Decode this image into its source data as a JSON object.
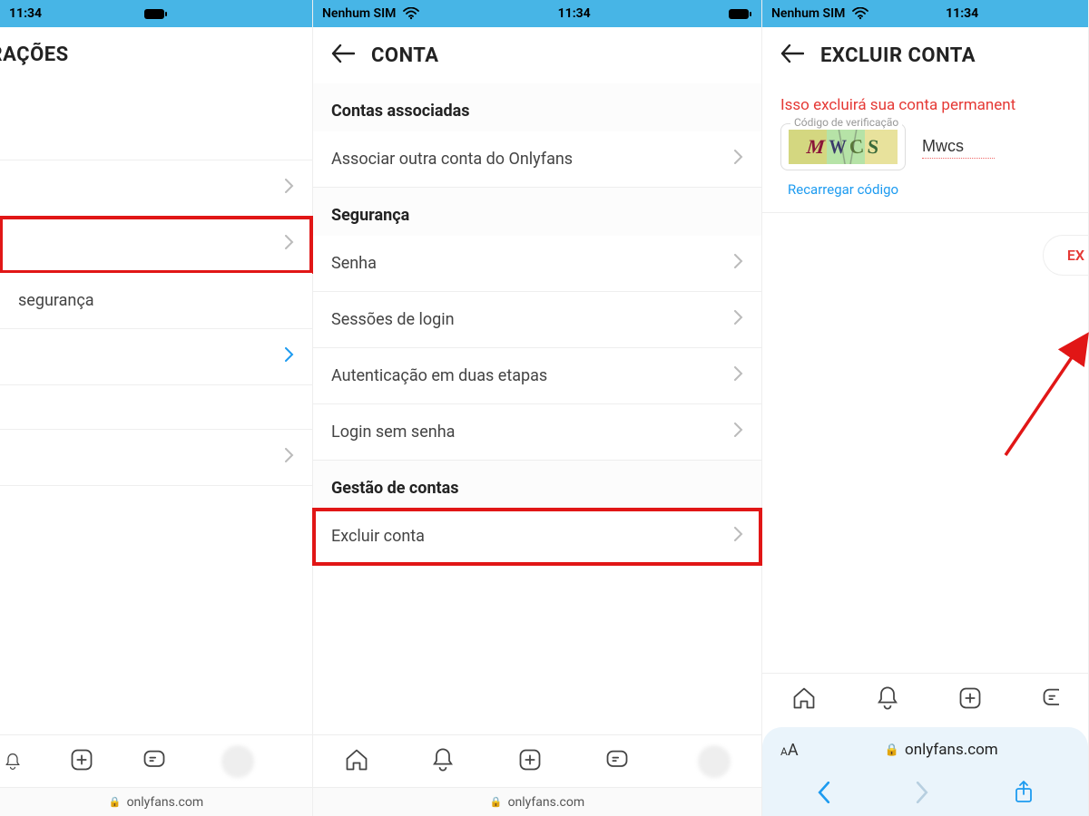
{
  "status": {
    "time": "11:34",
    "carrier": "Nenhum SIM"
  },
  "panel1": {
    "title": "GURAÇÕES",
    "items": {
      "row2_label": "segurança"
    },
    "url": "onlyfans.com"
  },
  "panel2": {
    "title": "CONTA",
    "section_linked": "Contas associadas",
    "item_link_other": "Associar outra conta do Onlyfans",
    "section_security": "Segurança",
    "item_password": "Senha",
    "item_sessions": "Sessões de login",
    "item_2fa": "Autenticação em duas etapas",
    "item_passwordless": "Login sem senha",
    "section_manage": "Gestão de contas",
    "item_delete": "Excluir conta",
    "url": "onlyfans.com"
  },
  "panel3": {
    "title": "EXCLUIR CONTA",
    "warning": "Isso excluirá sua conta permanent",
    "captcha_legend": "Código de verificação",
    "captcha_letters": [
      "M",
      "W",
      "C",
      "S"
    ],
    "captcha_input_value": "Mwcs",
    "reload": "Recarregar código",
    "delete_btn": "EX",
    "url": "onlyfans.com"
  }
}
